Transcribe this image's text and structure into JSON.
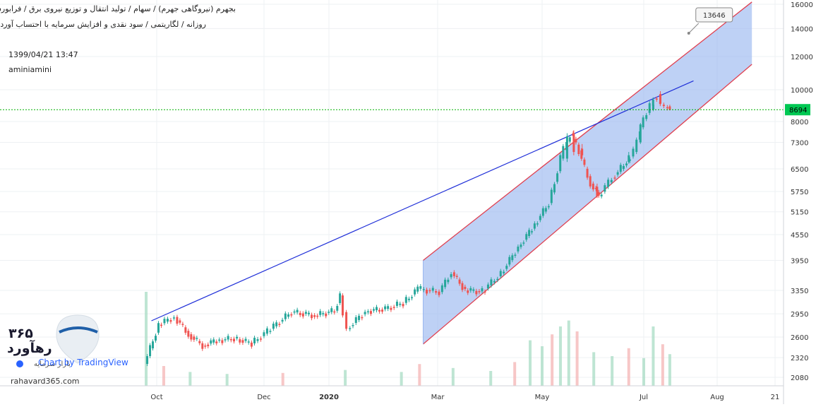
{
  "header": {
    "title": "بجهرم (نیروگاهی جهرم) / سهام / تولید انتقال و توزیع نیروی برق / فرابورس",
    "subtitle": "روزانه / لگاریتمی / سود نقدی و افزایش سرمایه با احتساب آورده",
    "timestamp": "1399/04/21 13:47",
    "author": "aminiamini"
  },
  "watermark": {
    "brand_number": "۳۶۵",
    "brand_name": "رهآورد",
    "tagline": "بازار سرمایه",
    "chart_by": "Chart by TradingView",
    "website": "rahavard365.com"
  },
  "colors": {
    "up": "#26a69a",
    "down": "#ef5350",
    "channel_fill": "#9bb8f0",
    "channel_edge": "#e04050",
    "trendline": "#1f2fd8",
    "price_line": "#00b000",
    "grid": "#eef0f3"
  },
  "chart_data": {
    "type": "candlestick",
    "scale": "logarithmic",
    "y_axis": {
      "ticks": [
        2080,
        2320,
        2600,
        2950,
        3350,
        3950,
        4550,
        5150,
        5750,
        6500,
        7300,
        8000,
        10000,
        12000,
        14000,
        16000
      ],
      "tick_labels": [
        "2080",
        "2320",
        "2600",
        "2950",
        "3350",
        "3950",
        "4550",
        "5150",
        "5750",
        "6500",
        "7300",
        "8000",
        "10000",
        "12000",
        "14000",
        "16000"
      ],
      "position": "right"
    },
    "x_axis": {
      "tick_labels": [
        "Oct",
        "Dec",
        "2020",
        "Mar",
        "May",
        "Jul",
        "Aug",
        "21"
      ],
      "tick_dates": [
        "2019-10-01",
        "2019-12-01",
        "2020-01-01",
        "2020-03-01",
        "2020-05-01",
        "2020-07-01",
        "2020-08-01",
        "2020-08-21"
      ]
    },
    "last_price": 8694,
    "target_label": 13646,
    "price_series": [
      [
        "2019-09-25",
        2240
      ],
      [
        "2019-10-03",
        2780
      ],
      [
        "2019-10-12",
        2900
      ],
      [
        "2019-10-20",
        2640
      ],
      [
        "2019-10-28",
        2480
      ],
      [
        "2019-11-05",
        2550
      ],
      [
        "2019-11-15",
        2580
      ],
      [
        "2019-11-25",
        2510
      ],
      [
        "2019-12-05",
        2720
      ],
      [
        "2019-12-15",
        2980
      ],
      [
        "2019-12-26",
        2920
      ],
      [
        "2020-01-05",
        3000
      ],
      [
        "2020-01-08",
        3260
      ],
      [
        "2020-01-12",
        2720
      ],
      [
        "2020-01-22",
        2990
      ],
      [
        "2020-02-02",
        3030
      ],
      [
        "2020-02-12",
        3130
      ],
      [
        "2020-02-20",
        3380
      ],
      [
        "2020-03-03",
        3320
      ],
      [
        "2020-03-10",
        3700
      ],
      [
        "2020-03-18",
        3350
      ],
      [
        "2020-03-28",
        3330
      ],
      [
        "2020-04-08",
        3680
      ],
      [
        "2020-04-18",
        4250
      ],
      [
        "2020-04-26",
        4700
      ],
      [
        "2020-05-06",
        5400
      ],
      [
        "2020-05-13",
        6800
      ],
      [
        "2020-05-19",
        7600
      ],
      [
        "2020-05-24",
        7050
      ],
      [
        "2020-05-31",
        6000
      ],
      [
        "2020-06-05",
        5600
      ],
      [
        "2020-06-13",
        6200
      ],
      [
        "2020-06-20",
        6600
      ],
      [
        "2020-06-26",
        7000
      ],
      [
        "2020-06-30",
        7800
      ],
      [
        "2020-07-03",
        8500
      ],
      [
        "2020-07-06",
        9400
      ],
      [
        "2020-07-09",
        9000
      ],
      [
        "2020-07-12",
        8694
      ]
    ],
    "candles": [
      [
        "2020-05-16",
        6800,
        7600,
        6700,
        7500
      ],
      [
        "2020-05-20",
        7600,
        7700,
        6900,
        7000
      ],
      [
        "2020-05-25",
        7100,
        7250,
        6850,
        6900
      ],
      [
        "2020-06-03",
        5900,
        6000,
        5550,
        5600
      ],
      [
        "2020-06-22",
        6700,
        7000,
        6650,
        6900
      ],
      [
        "2020-06-29",
        7300,
        7950,
        7250,
        7900
      ],
      [
        "2020-07-05",
        8700,
        9200,
        8600,
        9000
      ],
      [
        "2020-07-08",
        9700,
        9900,
        9000,
        9100
      ],
      [
        "2020-07-12",
        8900,
        9000,
        8650,
        8694
      ]
    ],
    "channel": {
      "lower": [
        [
          "2020-02-22",
          2500
        ],
        [
          "2020-08-13",
          11500
        ]
      ],
      "upper": [
        [
          "2020-02-22",
          3950
        ],
        [
          "2020-08-13",
          16200
        ]
      ],
      "line_from": [
        "2020-07-20",
        13646
      ]
    },
    "trendline": [
      [
        "2019-09-28",
        2840
      ],
      [
        "2020-07-22",
        10500
      ]
    ],
    "volume": {
      "unit": "relative",
      "series": [
        [
          "2019-09-25",
          0.95
        ],
        [
          "2019-10-05",
          0.2
        ],
        [
          "2019-10-20",
          0.14
        ],
        [
          "2019-11-10",
          0.12
        ],
        [
          "2019-12-10",
          0.13
        ],
        [
          "2020-01-10",
          0.16
        ],
        [
          "2020-02-10",
          0.14
        ],
        [
          "2020-02-20",
          0.22
        ],
        [
          "2020-03-10",
          0.18
        ],
        [
          "2020-04-01",
          0.15
        ],
        [
          "2020-04-15",
          0.24
        ],
        [
          "2020-04-24",
          0.46
        ],
        [
          "2020-05-01",
          0.4
        ],
        [
          "2020-05-07",
          0.52
        ],
        [
          "2020-05-12",
          0.6
        ],
        [
          "2020-05-17",
          0.66
        ],
        [
          "2020-05-22",
          0.55
        ],
        [
          "2020-06-01",
          0.34
        ],
        [
          "2020-06-12",
          0.3
        ],
        [
          "2020-06-22",
          0.38
        ],
        [
          "2020-07-01",
          0.28
        ],
        [
          "2020-07-05",
          0.6
        ],
        [
          "2020-07-09",
          0.42
        ],
        [
          "2020-07-12",
          0.32
        ]
      ]
    }
  }
}
